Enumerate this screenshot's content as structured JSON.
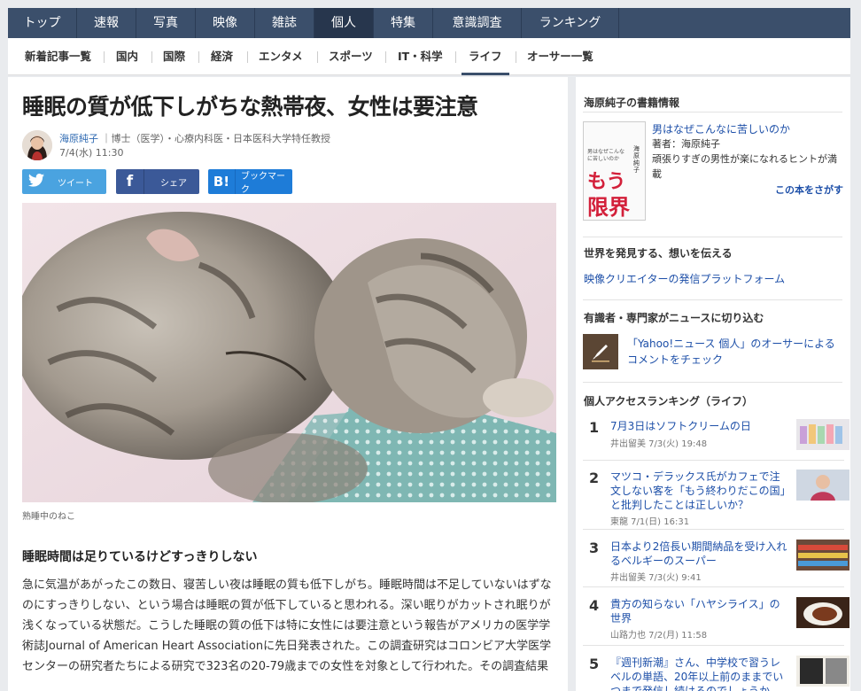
{
  "topnav": [
    "トップ",
    "速報",
    "写真",
    "映像",
    "雑誌",
    "個人",
    "特集",
    "意識調査",
    "ランキング"
  ],
  "subnav": [
    "新着記事一覧",
    "国内",
    "国際",
    "経済",
    "エンタメ",
    "スポーツ",
    "IT・科学",
    "ライフ",
    "オーサー一覧"
  ],
  "article": {
    "title": "睡眠の質が低下しがちな熱帯夜、女性は要注意",
    "author_name": "海原純子",
    "author_affiliation": "｜博士（医学）・心療内科医・日本医科大学特任教授",
    "date": "7/4(水) 11:30",
    "share": {
      "tweet": "ツイート",
      "facebook": "シェア",
      "hatena": "ブックマーク"
    },
    "photo_caption": "熟睡中のねこ",
    "subheading": "睡眠時間は足りているけどすっきりしない",
    "body": "急に気温があがったこの数日、寝苦しい夜は睡眠の質も低下しがち。睡眠時間は不足していないはずなのにすっきりしない、という場合は睡眠の質が低下していると思われる。深い眠りがカットされ眠りが浅くなっている状態だ。こうした睡眠の質の低下は特に女性には要注意という報告がアメリカの医学学術誌Journal of American Heart Associationに先日発表された。この調査研究はコロンビア大学医学センターの研究者たちによる研究で323名の20-79歳までの女性を対象として行われた。その調査結果"
  },
  "sidebar": {
    "book_section_title": "海原純子の書籍情報",
    "book_title": "男はなぜこんなに苦しいのか",
    "book_author": "著者：海原純子",
    "book_desc": "頑張りすぎの男性が楽になれるヒントが満載",
    "book_more": "この本をさがす",
    "book_cover_text_small": "男はなぜこんなに苦しいのか",
    "book_cover_text_big1": "もう",
    "book_cover_text_big2": "限界",
    "book_cover_author": "海原純子",
    "discover_title": "世界を発見する、想いを伝える",
    "discover_link": "映像クリエイターの発信プラットフォーム",
    "experts_title": "有識者・専門家がニュースに切り込む",
    "experts_link": "「Yahoo!ニュース 個人」のオーサーによるコメントをチェック",
    "ranking_title": "個人アクセスランキング（ライフ）",
    "ranking": [
      {
        "rank": "1",
        "title": "7月3日はソフトクリームの日",
        "meta": "井出留美 7/3(火) 19:48"
      },
      {
        "rank": "2",
        "title": "マツコ・デラックス氏がカフェで注文しない客を「もう終わりだこの国」と批判したことは正しいか？",
        "meta": "東龍 7/1(日) 16:31"
      },
      {
        "rank": "3",
        "title": "日本より2倍長い期間納品を受け入れるベルギーのスーパー",
        "meta": "井出留美 7/3(火) 9:41"
      },
      {
        "rank": "4",
        "title": "貴方の知らない「ハヤシライス」の世界",
        "meta": "山路力也 7/2(月) 11:58"
      },
      {
        "rank": "5",
        "title": "『週刊新潮』さん、中学校で習うレベルの単語、20年以上前のままでいつまで発信し続けるのでしょうか",
        "meta": ""
      }
    ]
  },
  "colors": {
    "nav_bg": "#3b4f6b",
    "nav_active": "#27364d",
    "link": "#1d4fa8",
    "twitter": "#4aa3e0",
    "facebook": "#3b5998",
    "hatena": "#1e7cd8"
  }
}
